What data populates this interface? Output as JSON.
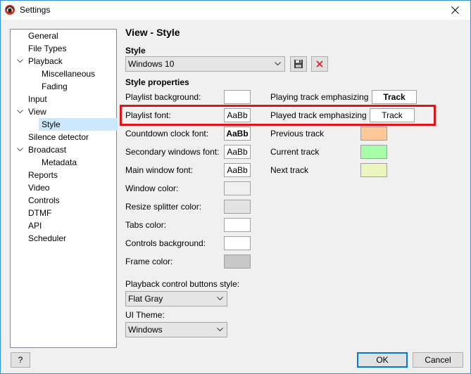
{
  "window": {
    "title": "Settings"
  },
  "tree": {
    "items": [
      {
        "label": "General",
        "level": 0
      },
      {
        "label": "File Types",
        "level": 0
      },
      {
        "label": "Playback",
        "level": 0,
        "expanded": true
      },
      {
        "label": "Miscellaneous",
        "level": 1
      },
      {
        "label": "Fading",
        "level": 1
      },
      {
        "label": "Input",
        "level": 0
      },
      {
        "label": "View",
        "level": 0,
        "expanded": true
      },
      {
        "label": "Style",
        "level": 1,
        "selected": true
      },
      {
        "label": "Silence detector",
        "level": 0
      },
      {
        "label": "Broadcast",
        "level": 0,
        "expanded": true
      },
      {
        "label": "Metadata",
        "level": 1
      },
      {
        "label": "Reports",
        "level": 0
      },
      {
        "label": "Video",
        "level": 0
      },
      {
        "label": "Controls",
        "level": 0
      },
      {
        "label": "DTMF",
        "level": 0
      },
      {
        "label": "API",
        "level": 0
      },
      {
        "label": "Scheduler",
        "level": 0
      }
    ]
  },
  "page": {
    "title": "View - Style",
    "style_label": "Style",
    "style_value": "Windows 10",
    "style_properties_label": "Style properties"
  },
  "properties_left": [
    {
      "label": "Playlist background:",
      "kind": "color",
      "color": "#ffffff"
    },
    {
      "label": "Playlist font:",
      "kind": "font",
      "sample": "AaBb"
    },
    {
      "label": "Countdown clock font:",
      "kind": "font",
      "sample": "AaBb",
      "bold": true
    },
    {
      "label": "Secondary windows font:",
      "kind": "font",
      "sample": "AaBb"
    },
    {
      "label": "Main window font:",
      "kind": "font",
      "sample": "AaBb"
    },
    {
      "label": "Window color:",
      "kind": "color",
      "color": "#f0f0f0"
    },
    {
      "label": "Resize splitter color:",
      "kind": "color",
      "color": "#e3e3e3"
    },
    {
      "label": "Tabs color:",
      "kind": "color",
      "color": "#ffffff"
    },
    {
      "label": "Controls background:",
      "kind": "color",
      "color": "#ffffff"
    },
    {
      "label": "Frame color:",
      "kind": "color",
      "color": "#c8c8c8"
    }
  ],
  "properties_right": [
    {
      "label": "Playing track emphasizing",
      "kind": "font",
      "sample": "Track",
      "bold": true
    },
    {
      "label": "Played track emphasizing",
      "kind": "font",
      "sample": "Track"
    },
    {
      "label": "Previous track",
      "kind": "color",
      "color": "#ffc896"
    },
    {
      "label": "Current track",
      "kind": "color",
      "color": "#a6ffa6"
    },
    {
      "label": "Next track",
      "kind": "color",
      "color": "#ebf5be"
    }
  ],
  "playback_buttons": {
    "label": "Playback control buttons style:",
    "value": "Flat Gray"
  },
  "ui_theme": {
    "label": "UI Theme:",
    "value": "Windows"
  },
  "buttons": {
    "help": "?",
    "ok": "OK",
    "cancel": "Cancel"
  },
  "colors": {
    "highlight": "#e0151a",
    "selection": "#cce8ff",
    "accent": "#0078d7"
  }
}
